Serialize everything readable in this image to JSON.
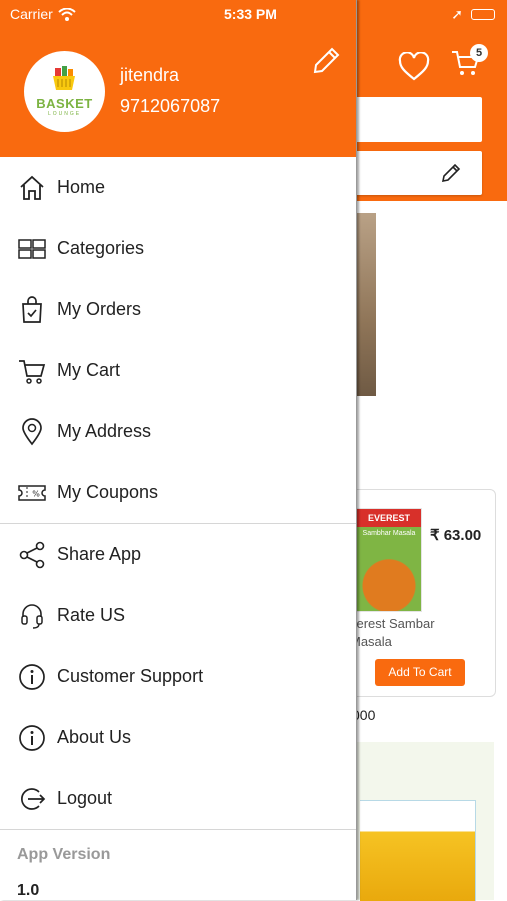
{
  "status_bar": {
    "carrier": "Carrier",
    "time": "5:33 PM"
  },
  "profile": {
    "name": "jitendra",
    "phone": "9712067087",
    "logo_text": "BASKET",
    "logo_subtext": "LOUNGE"
  },
  "menu_primary": [
    {
      "label": "Home",
      "icon": "home-icon"
    },
    {
      "label": "Categories",
      "icon": "grid-icon"
    },
    {
      "label": "My Orders",
      "icon": "shopping-bag-icon"
    },
    {
      "label": "My Cart",
      "icon": "cart-icon"
    },
    {
      "label": "My Address",
      "icon": "location-pin-icon"
    },
    {
      "label": "My Coupons",
      "icon": "coupon-icon"
    }
  ],
  "menu_secondary": [
    {
      "label": "Share App",
      "icon": "share-icon"
    },
    {
      "label": "Rate US",
      "icon": "headset-icon"
    },
    {
      "label": "Customer Support",
      "icon": "info-icon"
    },
    {
      "label": "About Us",
      "icon": "info-icon"
    },
    {
      "label": "Logout",
      "icon": "logout-icon"
    }
  ],
  "app_version": {
    "label": "App Version",
    "value": "1.0"
  },
  "background": {
    "cart_count": "5",
    "product": {
      "brand_label": "EVEREST",
      "pack_label": "Sambhar Masala",
      "price": "₹ 63.00",
      "name": "verest Sambar Masala",
      "button": "Add To Cart"
    },
    "partial_text": "000"
  },
  "colors": {
    "accent": "#f96a0f",
    "text": "#222222",
    "muted": "#999999"
  }
}
